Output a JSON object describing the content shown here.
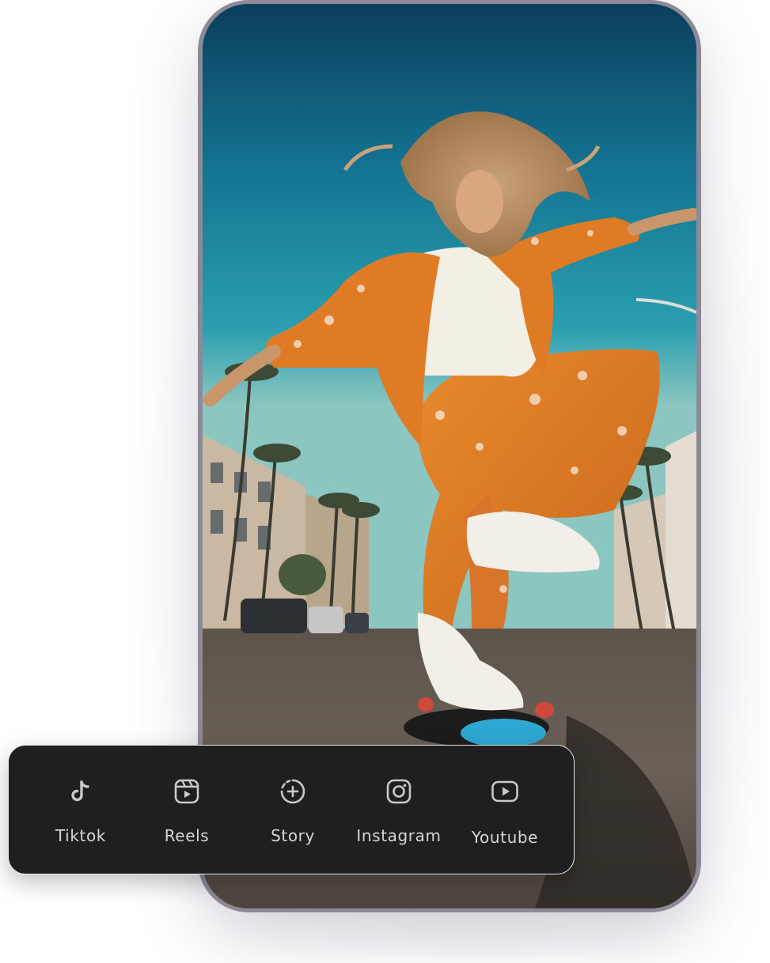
{
  "share_options": [
    {
      "label": "Tiktok",
      "icon": "tiktok-icon"
    },
    {
      "label": "Reels",
      "icon": "reels-icon"
    },
    {
      "label": "Story",
      "icon": "story-icon"
    },
    {
      "label": "Instagram",
      "icon": "instagram-icon"
    },
    {
      "label": "Youtube",
      "icon": "youtube-icon"
    }
  ],
  "colors": {
    "bar_background": "#1f1f21",
    "icon_color": "#c9c9cc",
    "label_color": "#d6d6d9",
    "phone_frame": "#8d8a97"
  }
}
